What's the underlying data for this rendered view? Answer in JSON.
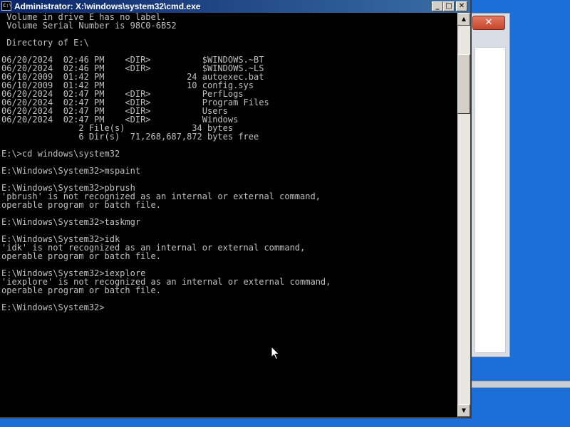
{
  "window": {
    "title": "Administrator: X:\\windows\\system32\\cmd.exe",
    "icon_label": "C:\\"
  },
  "titlebar_buttons": {
    "minimize": "_",
    "maximize": "□",
    "close": "✕"
  },
  "background_window": {
    "close_glyph": "✕"
  },
  "console": {
    "lines": [
      " Volume in drive E has no label.",
      " Volume Serial Number is 98C0-6B52",
      "",
      " Directory of E:\\",
      "",
      "06/20/2024  02:46 PM    <DIR>          $WINDOWS.~BT",
      "06/20/2024  02:46 PM    <DIR>          $WINDOWS.~LS",
      "06/10/2009  01:42 PM                24 autoexec.bat",
      "06/10/2009  01:42 PM                10 config.sys",
      "06/20/2024  02:47 PM    <DIR>          PerfLogs",
      "06/20/2024  02:47 PM    <DIR>          Program Files",
      "06/20/2024  02:47 PM    <DIR>          Users",
      "06/20/2024  02:47 PM    <DIR>          Windows",
      "               2 File(s)             34 bytes",
      "               6 Dir(s)  71,268,687,872 bytes free",
      "",
      "E:\\>cd windows\\system32",
      "",
      "E:\\Windows\\System32>mspaint",
      "",
      "E:\\Windows\\System32>pbrush",
      "'pbrush' is not recognized as an internal or external command,",
      "operable program or batch file.",
      "",
      "E:\\Windows\\System32>taskmgr",
      "",
      "E:\\Windows\\System32>idk",
      "'idk' is not recognized as an internal or external command,",
      "operable program or batch file.",
      "",
      "E:\\Windows\\System32>iexplore",
      "'iexplore' is not recognized as an internal or external command,",
      "operable program or batch file.",
      "",
      "E:\\Windows\\System32>"
    ]
  },
  "scrollbar": {
    "up_glyph": "▲",
    "down_glyph": "▼"
  },
  "colors": {
    "desktop": "#1c6fd6",
    "console_bg": "#000000",
    "console_fg": "#c0c0c0",
    "titlebar_start": "#0a246a",
    "titlebar_end": "#3a6ea5"
  },
  "icons": {
    "title_icon": "cmd-icon",
    "cursor": "mouse-pointer-icon"
  }
}
